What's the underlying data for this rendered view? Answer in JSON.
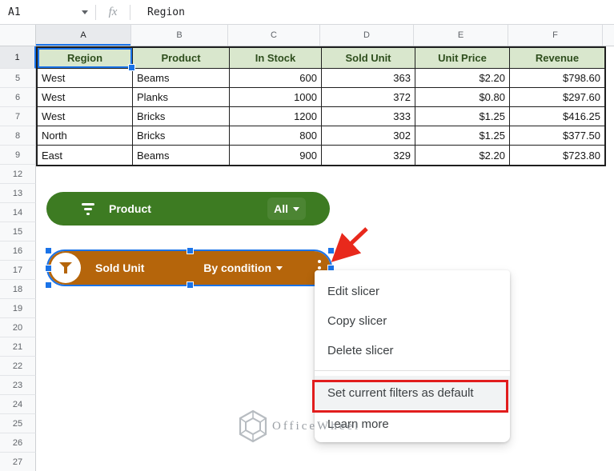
{
  "formula_bar": {
    "cell_ref": "A1",
    "fx_label": "fx",
    "value": "Region"
  },
  "sheet": {
    "column_headers": [
      "A",
      "B",
      "C",
      "D",
      "E",
      "F"
    ],
    "selected_column": "A",
    "row_labels": [
      "1",
      "5",
      "6",
      "7",
      "8",
      "9",
      "12",
      "13",
      "14",
      "15",
      "16",
      "17",
      "18",
      "19",
      "20",
      "21",
      "22",
      "23",
      "24",
      "25",
      "26",
      "27"
    ],
    "selected_row": "1",
    "selected_cell": "A1"
  },
  "table": {
    "headers": [
      "Region",
      "Product",
      "In Stock",
      "Sold Unit",
      "Unit Price",
      "Revenue"
    ],
    "rows": [
      [
        "West",
        "Beams",
        "600",
        "363",
        "$2.20",
        "$798.60"
      ],
      [
        "West",
        "Planks",
        "1000",
        "372",
        "$0.80",
        "$297.60"
      ],
      [
        "West",
        "Bricks",
        "1200",
        "333",
        "$1.25",
        "$416.25"
      ],
      [
        "North",
        "Bricks",
        "800",
        "302",
        "$1.25",
        "$377.50"
      ],
      [
        "East",
        "Beams",
        "900",
        "329",
        "$2.20",
        "$723.80"
      ]
    ]
  },
  "slicers": {
    "product": {
      "title": "Product",
      "value": "All",
      "color": "#3d7b22"
    },
    "sold_unit": {
      "title": "Sold Unit",
      "value": "By condition",
      "color": "#b5650b",
      "selected": true
    }
  },
  "context_menu": {
    "items": [
      {
        "label": "Edit slicer"
      },
      {
        "label": "Copy slicer"
      },
      {
        "label": "Delete slicer"
      },
      {
        "type": "divider"
      },
      {
        "label": "Set current filters as default",
        "highlighted": true
      },
      {
        "label": "Learn more"
      }
    ]
  },
  "watermark": {
    "text": "OfficeWheel"
  },
  "colors": {
    "selection_blue": "#1a73e8",
    "slicer_green": "#3d7b22",
    "slicer_orange": "#b5650b",
    "table_header_bg": "#d9e7cd",
    "table_header_text": "#2e4e1d",
    "highlight_red": "#e11d1d"
  }
}
